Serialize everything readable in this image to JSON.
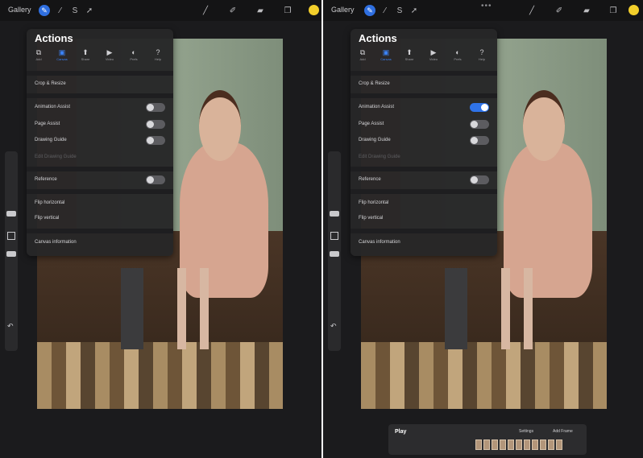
{
  "colors": {
    "accent": "#2f73e8",
    "panel_bg": "#262628",
    "canvas_bg": "#1b1b1d",
    "color_swatch": "#f3cf2b"
  },
  "toolbar": {
    "gallery_label": "Gallery",
    "icons": [
      "wrench-icon",
      "magic-wand-icon",
      "selection-icon",
      "transform-icon",
      "brush-icon",
      "smudge-icon",
      "eraser-icon",
      "layers-icon"
    ],
    "more_dots": "•••"
  },
  "panes": [
    {
      "actions": {
        "title": "Actions",
        "tabs": [
          {
            "label": "Add",
            "icon": "add-icon",
            "selected": false
          },
          {
            "label": "Canvas",
            "icon": "canvas-icon",
            "selected": true
          },
          {
            "label": "Share",
            "icon": "share-icon",
            "selected": false
          },
          {
            "label": "Video",
            "icon": "video-icon",
            "selected": false
          },
          {
            "label": "Prefs",
            "icon": "prefs-icon",
            "selected": false
          },
          {
            "label": "Help",
            "icon": "help-icon",
            "selected": false
          }
        ],
        "items": {
          "crop": "Crop & Resize",
          "animation_assist": "Animation Assist",
          "page_assist": "Page Assist",
          "drawing_guide": "Drawing Guide",
          "edit_drawing_guide": "Edit Drawing Guide",
          "reference": "Reference",
          "flip_horizontal": "Flip horizontal",
          "flip_vertical": "Flip vertical",
          "canvas_information": "Canvas information"
        },
        "toggles": {
          "animation_assist": false,
          "page_assist": false,
          "drawing_guide": false,
          "reference": false
        }
      }
    },
    {
      "actions": {
        "title": "Actions",
        "tabs": [
          {
            "label": "Add",
            "icon": "add-icon",
            "selected": false
          },
          {
            "label": "Canvas",
            "icon": "canvas-icon",
            "selected": true
          },
          {
            "label": "Share",
            "icon": "share-icon",
            "selected": false
          },
          {
            "label": "Video",
            "icon": "video-icon",
            "selected": false
          },
          {
            "label": "Prefs",
            "icon": "prefs-icon",
            "selected": false
          },
          {
            "label": "Help",
            "icon": "help-icon",
            "selected": false
          }
        ],
        "items": {
          "crop": "Crop & Resize",
          "animation_assist": "Animation Assist",
          "page_assist": "Page Assist",
          "drawing_guide": "Drawing Guide",
          "edit_drawing_guide": "Edit Drawing Guide",
          "reference": "Reference",
          "flip_horizontal": "Flip horizontal",
          "flip_vertical": "Flip vertical",
          "canvas_information": "Canvas information"
        },
        "toggles": {
          "animation_assist": true,
          "page_assist": false,
          "drawing_guide": false,
          "reference": false
        }
      }
    }
  ],
  "animation_bar": {
    "play_label": "Play",
    "settings_label": "Settings",
    "add_frame_label": "Add Frame",
    "frame_count": 11
  }
}
